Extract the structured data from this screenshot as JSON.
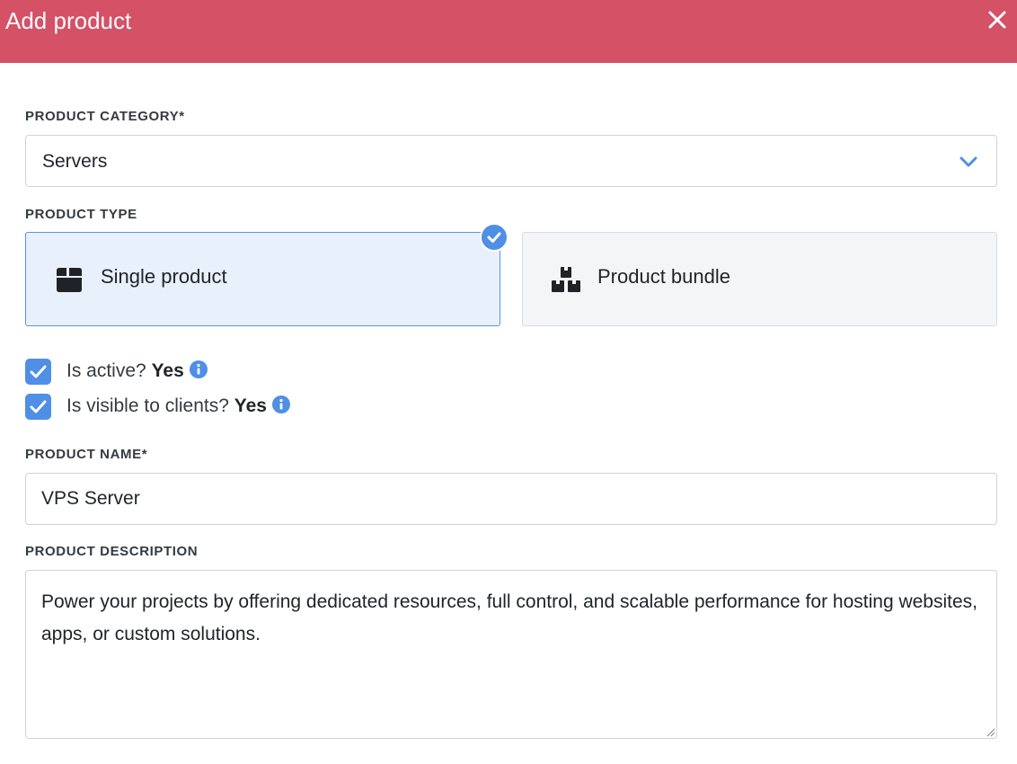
{
  "header": {
    "title": "Add product",
    "close_icon": "close-icon",
    "background_color": "#d45166"
  },
  "category": {
    "label": "PRODUCT CATEGORY*",
    "selected_value": "Servers",
    "icon": "chevron-down-icon"
  },
  "product_type": {
    "label": "PRODUCT TYPE",
    "options": [
      {
        "label": "Single product",
        "icon": "box-icon",
        "selected": true
      },
      {
        "label": "Product bundle",
        "icon": "boxes-icon",
        "selected": false
      }
    ],
    "accent_color": "#4f8fe6"
  },
  "toggles": [
    {
      "label": "Is active?",
      "value": "Yes",
      "checked": true,
      "icon": "info-icon"
    },
    {
      "label": "Is visible to clients?",
      "value": "Yes",
      "checked": true,
      "icon": "info-icon"
    }
  ],
  "name": {
    "label": "PRODUCT NAME*",
    "value": "VPS Server"
  },
  "description": {
    "label": "PRODUCT DESCRIPTION",
    "value": "Power your projects by offering dedicated resources, full control, and scalable performance for hosting websites, apps, or custom solutions."
  }
}
